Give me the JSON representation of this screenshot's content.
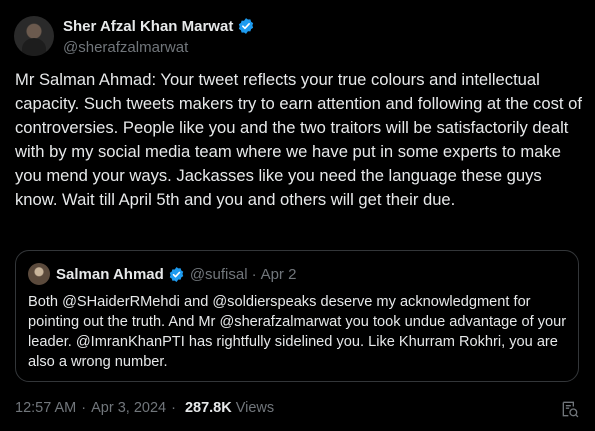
{
  "author": {
    "display_name": "Sher Afzal Khan Marwat",
    "handle": "@sherafzalmarwat",
    "verified_icon": "verified-badge-icon"
  },
  "post": {
    "text": "Mr Salman Ahmad: Your tweet reflects your true colours and intellectual capacity. Such tweets makers try to earn attention and following at the cost of controversies. People like you and the two traitors will be satisfactorily dealt with by my social media team where we have put in some experts to make you mend your ways. Jackasses like you need the language these guys know. Wait till April 5th and you and others will get their due."
  },
  "quote": {
    "display_name": "Salman Ahmad",
    "handle": "@sufisal",
    "separator": "·",
    "date": "Apr 2",
    "text": "Both @SHaiderRMehdi and @soldierspeaks deserve my acknowledgment for pointing out the truth. And Mr @sherafzalmarwat you took undue advantage of your leader. @ImranKhanPTI has rightfully sidelined you. Like Khurram Rokhri, you are also a wrong number."
  },
  "meta": {
    "time": "12:57 AM",
    "separator": "·",
    "date": "Apr 3, 2024",
    "views_count": "287.8K",
    "views_label": "Views"
  },
  "colors": {
    "background": "#000000",
    "text": "#e7e9ea",
    "muted": "#71767b",
    "verified": "#1d9bf0",
    "border": "#333639"
  }
}
